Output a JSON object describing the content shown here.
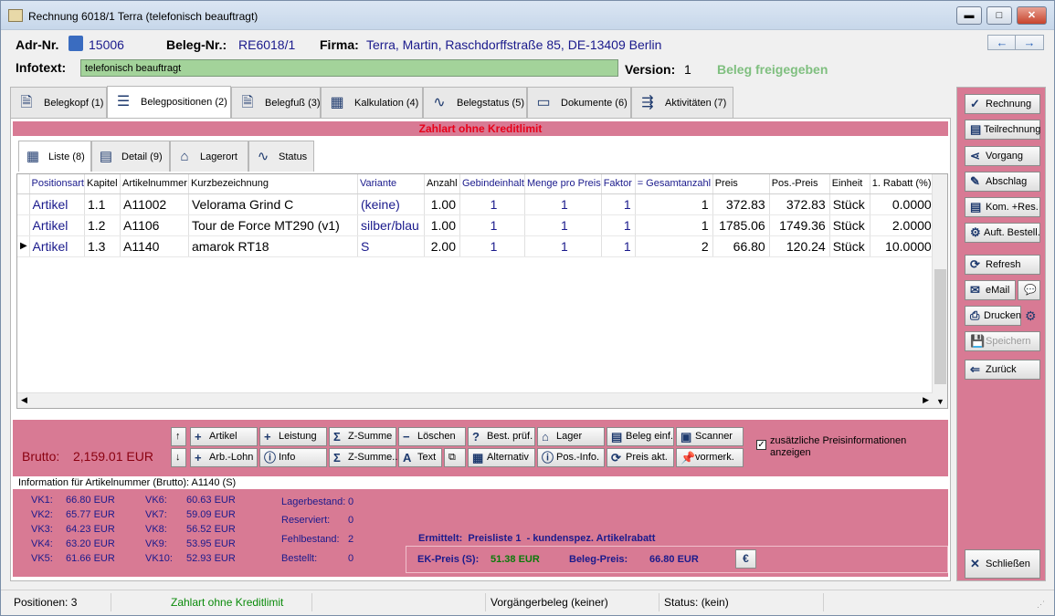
{
  "window": {
    "title": "Rechnung 6018/1 Terra (telefonisch beauftragt)",
    "min": "▬",
    "max": "□",
    "close": "✕"
  },
  "header": {
    "adr_label": "Adr-Nr.",
    "adr_value": "15006",
    "beleg_label": "Beleg-Nr.:",
    "beleg_value": "RE6018/1",
    "firma_label": "Firma:",
    "firma_value": "Terra, Martin, Raschdorffstraße 85, DE-13409 Berlin",
    "infotext_label": "Infotext:",
    "infotext_value": "telefonisch beauftragt",
    "version_label": "Version:",
    "version_value": "1",
    "status": "Beleg freigegeben",
    "nav_back": "←",
    "nav_fwd": "→"
  },
  "tabs": [
    {
      "label": "Belegkopf (1)"
    },
    {
      "label": "Belegpositionen (2)"
    },
    {
      "label": "Belegfuß (3)"
    },
    {
      "label": "Kalkulation (4)"
    },
    {
      "label": "Belegstatus (5)"
    },
    {
      "label": "Dokumente (6)"
    },
    {
      "label": "Aktivitäten (7)"
    }
  ],
  "banner": "Zahlart ohne Kreditlimit",
  "subtabs": [
    {
      "label": "Liste (8)"
    },
    {
      "label": "Detail (9)"
    },
    {
      "label": "Lagerort"
    },
    {
      "label": "Status"
    }
  ],
  "grid": {
    "columns": [
      "Positionsart",
      "Kapitel",
      "Artikelnummer",
      "Kurzbezeichnung",
      "Variante",
      "Anzahl",
      "Gebindeinhalt",
      "Menge pro Preis",
      "Faktor",
      "= Gesamtanzahl",
      "Preis",
      "Pos.-Preis",
      "Einheit",
      "1. Rabatt (%)"
    ],
    "rows": [
      [
        "Artikel",
        "1.1",
        "A11002",
        "Velorama Grind C",
        "(keine)",
        "1.00",
        "1",
        "1",
        "1",
        "1",
        "372.83",
        "372.83",
        "Stück",
        "0.0000"
      ],
      [
        "Artikel",
        "1.2",
        "A1106",
        "Tour de Force MT290 (v1)",
        "silber/blau",
        "1.00",
        "1",
        "1",
        "1",
        "1",
        "1785.06",
        "1749.36",
        "Stück",
        "2.0000"
      ],
      [
        "Artikel",
        "1.3",
        "A1140",
        "amarok RT18",
        "S",
        "2.00",
        "1",
        "1",
        "1",
        "2",
        "66.80",
        "120.24",
        "Stück",
        "10.0000"
      ]
    ],
    "current_marker": "▶"
  },
  "brutto": {
    "label": "Brutto:",
    "value": "2,159.01 EUR"
  },
  "actions": {
    "artikel": "Artikel",
    "leistung": "Leistung",
    "zsumme": "Z-Summe",
    "loeschen": "Löschen",
    "best_pruef": "Best. prüf.",
    "lager": "Lager",
    "beleg_einf": "Beleg einf.",
    "scanner": "Scanner",
    "arb_lohn": "Arb.-Lohn",
    "info": "Info",
    "zsumme2": "Z-Summe..",
    "text": "Text",
    "alternativ": "Alternativ",
    "pos_info": "Pos.-Info.",
    "preis_akt": "Preis akt.",
    "vormerk": "vormerk.",
    "checkbox_label": "zusätzliche Preisinformationen anzeigen"
  },
  "info_panel": {
    "title": "Information für Artikelnummer (Brutto): A1140 (S)",
    "vk_left": [
      [
        "VK1:",
        "66.80 EUR"
      ],
      [
        "VK2:",
        "65.77 EUR"
      ],
      [
        "VK3:",
        "64.23 EUR"
      ],
      [
        "VK4:",
        "63.20 EUR"
      ],
      [
        "VK5:",
        "61.66 EUR"
      ]
    ],
    "vk_right": [
      [
        "VK6:",
        "60.63 EUR"
      ],
      [
        "VK7:",
        "59.09 EUR"
      ],
      [
        "VK8:",
        "56.52 EUR"
      ],
      [
        "VK9:",
        "53.95 EUR"
      ],
      [
        "VK10:",
        "52.93 EUR"
      ]
    ],
    "stock": [
      [
        "Lagerbestand:",
        "0"
      ],
      [
        "Reserviert:",
        "0"
      ],
      [
        "Fehlbestand:",
        "2"
      ],
      [
        "Bestellt:",
        "0"
      ]
    ],
    "ermittelt": "Ermittelt:  Preisliste 1  - kundenspez. Artikelrabatt",
    "ek_label": "EK-Preis (S):",
    "ek_value": "51.38 EUR",
    "beleg_preis_label": "Beleg-Preis:",
    "beleg_preis_value": "66.80 EUR",
    "euro_icon": "€"
  },
  "sidebar": {
    "rechnung": "Rechnung",
    "teilrechnung": "Teilrechnung",
    "vorgang": "Vorgang",
    "abschlag": "Abschlag",
    "kom_res": "Kom. +Res.",
    "auft_bestell": "Auft. Bestell.",
    "refresh": "Refresh",
    "email": "eMail",
    "drucken": "Drucken",
    "speichern": "Speichern",
    "zurueck": "Zurück",
    "schliessen": "Schließen"
  },
  "statusbar": {
    "positionen": "Positionen: 3",
    "zahlart": "Zahlart ohne Kreditlimit",
    "vorgaenger": "Vorgängerbeleg (keiner)",
    "status": "Status: (kein)"
  },
  "colors": {
    "pink": "#d87a94",
    "banner_text": "#e8001a",
    "status_green": "#7fbf7f",
    "infobox": "#a3d39a"
  }
}
